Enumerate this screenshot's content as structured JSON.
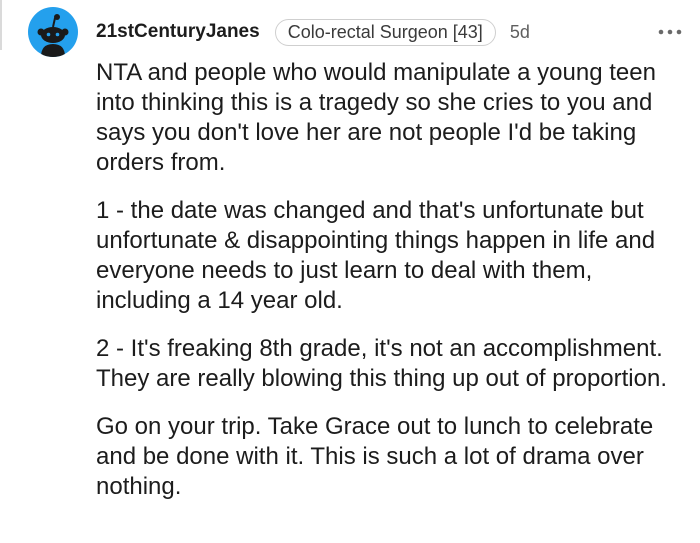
{
  "comment": {
    "username": "21stCenturyJanes",
    "flair": "Colo-rectal Surgeon [43]",
    "age": "5d",
    "more_icon": "ellipsis-icon",
    "avatar_icon": "reddit-snoo-avatar-icon",
    "colors": {
      "avatar_bg": "#24a0ed",
      "text": "#1c1c1c",
      "meta": "#5f5f5f"
    },
    "paragraphs": [
      "NTA and people who would manipulate a young teen into thinking this is a tragedy so she cries to you and says you don't love her are not people I'd be taking orders from.",
      "1 - the date was changed and that's unfortunate but unfortunate & disappointing things happen in life and everyone needs to just learn to deal with them, including a 14 year old.",
      "2 - It's freaking 8th grade, it's not an accomplishment. They are really blowing this thing up out of proportion.",
      "Go on your trip. Take Grace out to lunch to celebrate and be done with it. This is such a lot of drama over nothing."
    ]
  }
}
